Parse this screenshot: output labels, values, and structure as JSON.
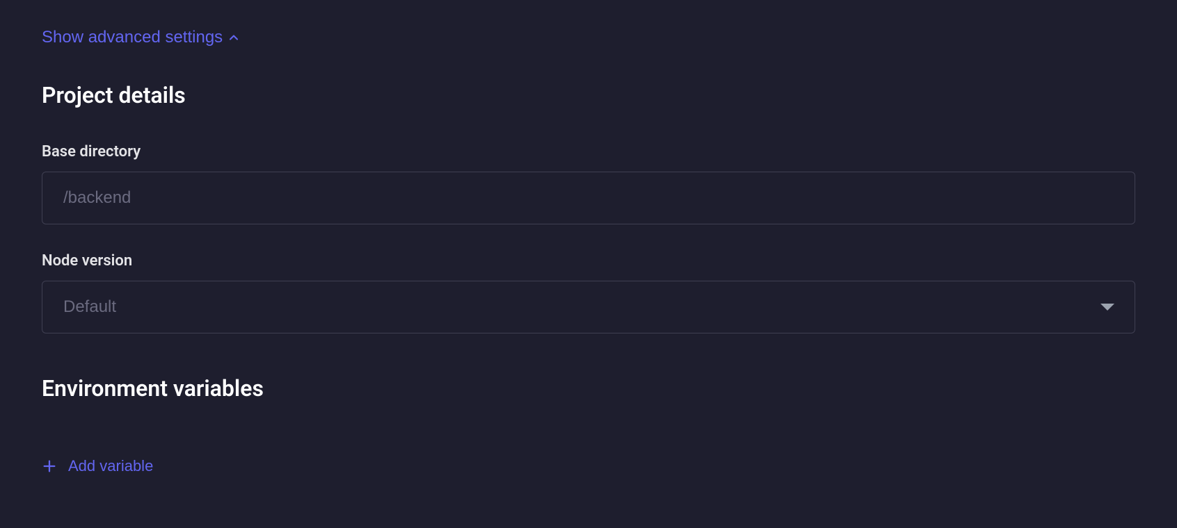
{
  "advanced_toggle": {
    "label": "Show advanced settings"
  },
  "sections": {
    "project_details": {
      "heading": "Project details",
      "base_directory": {
        "label": "Base directory",
        "placeholder": "/backend",
        "value": ""
      },
      "node_version": {
        "label": "Node version",
        "selected": "Default"
      }
    },
    "environment_variables": {
      "heading": "Environment variables",
      "add_button_label": "Add variable"
    }
  }
}
